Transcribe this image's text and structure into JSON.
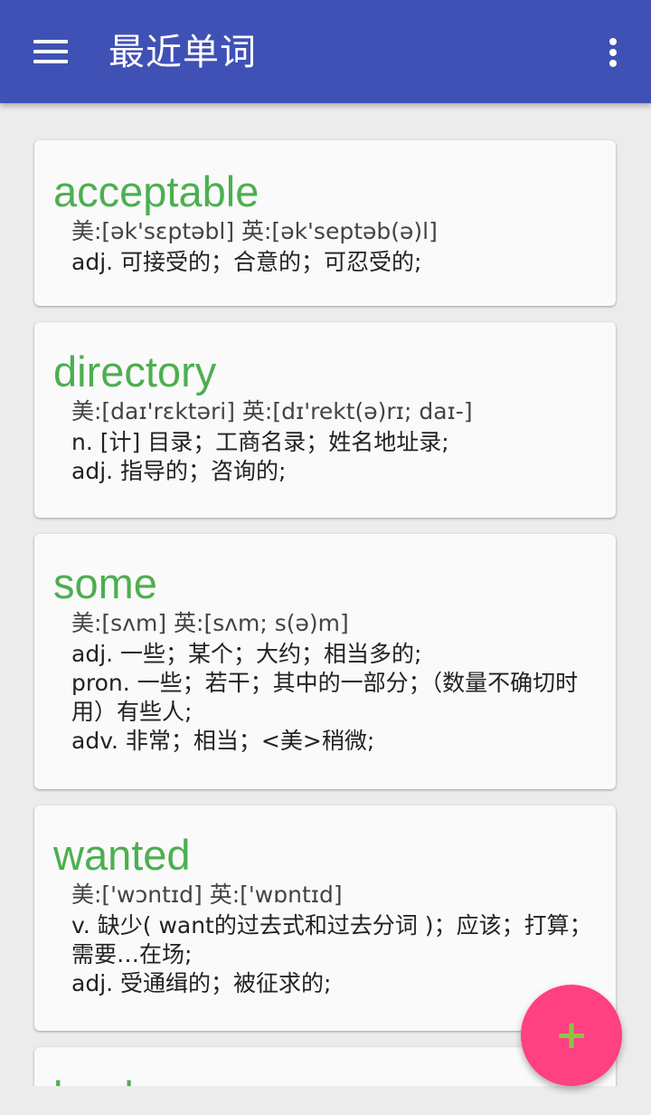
{
  "appbar": {
    "title": "最近单词",
    "menu_icon": "hamburger-menu-icon",
    "overflow_icon": "more-vert-icon",
    "background": "#3f51b5"
  },
  "words": [
    {
      "word": "acceptable",
      "phonetic": "美:[ək'sɛptəbl] 英:[ək'septəb(ə)l]",
      "definitions": [
        "adj. 可接受的；合意的；可忍受的;"
      ]
    },
    {
      "word": "directory",
      "phonetic": "美:[daɪ'rɛktəri] 英:[dɪ'rekt(ə)rɪ; daɪ-]",
      "definitions": [
        "n. [计] 目录；工商名录；姓名地址录;",
        "adj. 指导的；咨询的;"
      ]
    },
    {
      "word": "some",
      "phonetic": "美:[sʌm] 英:[sʌm; s(ə)m]",
      "definitions": [
        "adj. 一些；某个；大约；相当多的;",
        "pron. 一些；若干；其中的一部分；（数量不确切时用）有些人;",
        "adv. 非常；相当；<美>稍微;"
      ]
    },
    {
      "word": "wanted",
      "phonetic": "美:['wɔntɪd] 英:['wɒntɪd]",
      "definitions": [
        "v. 缺少( want的过去式和过去分词 )；应该；打算；需要…在场;",
        "adj. 受通缉的；被征求的;"
      ]
    },
    {
      "word": "book",
      "phonetic": "",
      "definitions": []
    }
  ],
  "fab": {
    "label": "+",
    "icon": "add-icon",
    "background": "#ff4081",
    "icon_color": "#8bc34a"
  },
  "colors": {
    "word": "#4caf50",
    "card": "#fafafa",
    "page": "#ececec"
  }
}
